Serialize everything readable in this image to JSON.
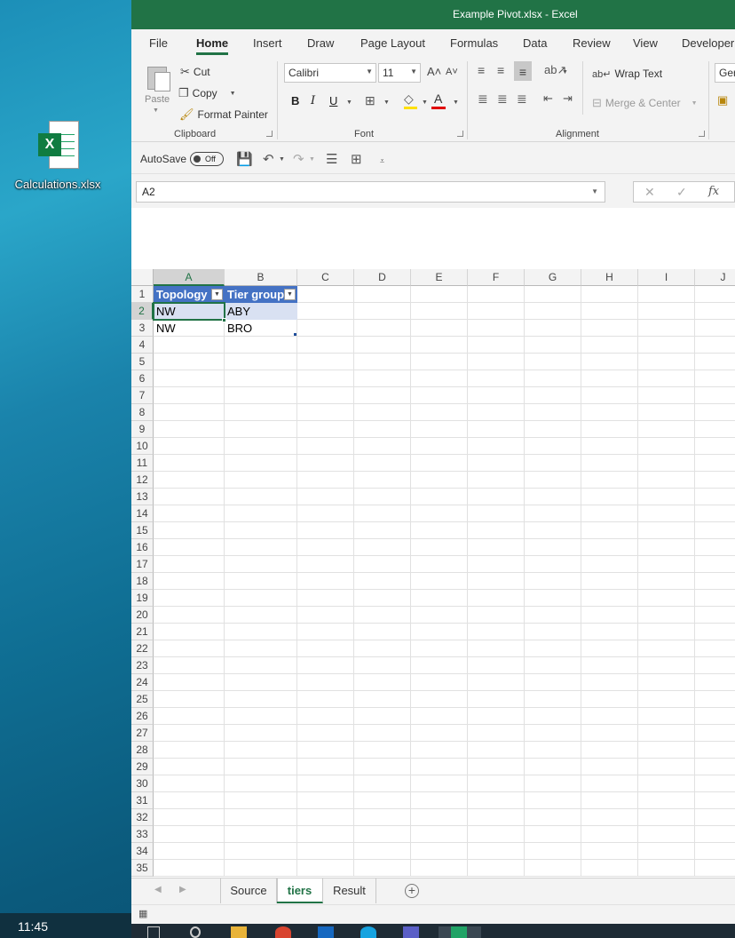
{
  "desktop": {
    "icon_label": "Calculations.xlsx",
    "clock": "11:45"
  },
  "window": {
    "title": "Example Pivot.xlsx  -  Excel"
  },
  "ribbon_tabs": [
    "File",
    "Home",
    "Insert",
    "Draw",
    "Page Layout",
    "Formulas",
    "Data",
    "Review",
    "View",
    "Developer"
  ],
  "active_tab": "Home",
  "clipboard": {
    "paste": "Paste",
    "cut": "Cut",
    "copy": "Copy",
    "format_painter": "Format Painter",
    "group_label": "Clipboard"
  },
  "font": {
    "name": "Calibri",
    "size": "11",
    "bold": "B",
    "italic": "I",
    "underline": "U",
    "group_label": "Font",
    "fill_color": "#ffe000",
    "font_color": "#e00000"
  },
  "alignment": {
    "wrap_text": "Wrap Text",
    "merge_center": "Merge & Center",
    "group_label": "Alignment"
  },
  "number": {
    "format_partial": "Ger"
  },
  "qat": {
    "autosave": "AutoSave",
    "toggle": "Off"
  },
  "formula_bar": {
    "name_box": "A2",
    "cancel": "✕",
    "enter": "✓",
    "fx": "fx"
  },
  "columns": [
    "A",
    "B",
    "C",
    "D",
    "E",
    "F",
    "G",
    "H",
    "I",
    "J"
  ],
  "rows": [
    "1",
    "2",
    "3",
    "4",
    "5",
    "6",
    "7",
    "8",
    "9",
    "10",
    "11",
    "12",
    "13",
    "14",
    "15",
    "16",
    "17",
    "18",
    "19",
    "20",
    "21",
    "22",
    "23",
    "24",
    "25",
    "26",
    "27",
    "28",
    "29",
    "30",
    "31",
    "32",
    "33",
    "34",
    "35"
  ],
  "table": {
    "headers": [
      "Topology",
      "Tier group"
    ],
    "rows": [
      [
        "NW",
        "ABY"
      ],
      [
        "NW",
        "BRO"
      ]
    ]
  },
  "sheets": [
    "Source",
    "tiers",
    "Result"
  ],
  "active_sheet": "tiers",
  "colors": {
    "excel_green": "#217346",
    "table_header": "#4472c4",
    "table_band": "#d9e1f2"
  }
}
